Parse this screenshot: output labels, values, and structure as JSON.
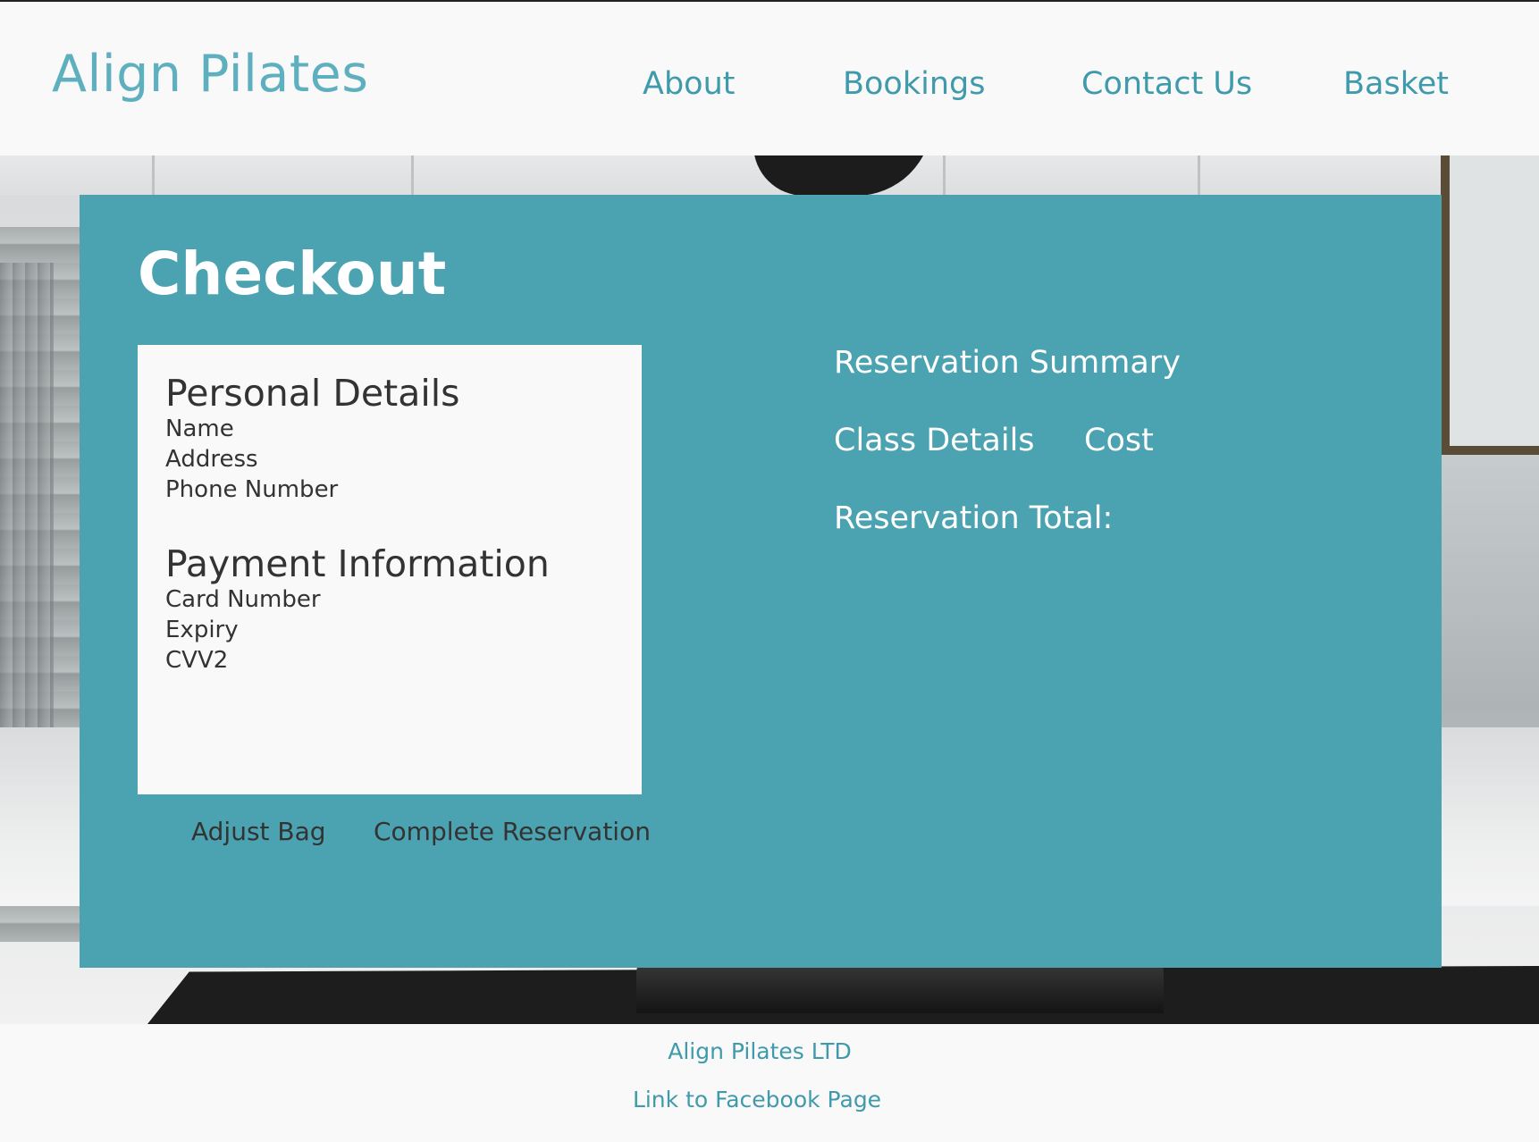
{
  "header": {
    "logo": "Align Pilates",
    "nav": {
      "about": "About",
      "bookings": "Bookings",
      "contact": "Contact Us",
      "basket": "Basket"
    }
  },
  "checkout": {
    "title": "Checkout",
    "personal_details": {
      "heading": "Personal Details",
      "fields": [
        "Name",
        "Address",
        "Phone Number"
      ]
    },
    "payment_information": {
      "heading": "Payment Information",
      "fields": [
        "Card Number",
        "Expiry",
        "CVV2"
      ]
    },
    "actions": {
      "adjust_bag": "Adjust Bag",
      "complete_reservation": "Complete Reservation"
    },
    "summary": {
      "title": "Reservation Summary",
      "class_details": "Class Details",
      "cost": "Cost",
      "total": "Reservation Total:"
    }
  },
  "footer": {
    "company": "Align Pilates LTD",
    "facebook_link": "Link to Facebook Page"
  },
  "colors": {
    "accent": "#4ba2b0",
    "link": "#3f9aab",
    "logo": "#5fb0bf",
    "card_bg": "#f9f9f9",
    "dark_text": "#333333"
  }
}
